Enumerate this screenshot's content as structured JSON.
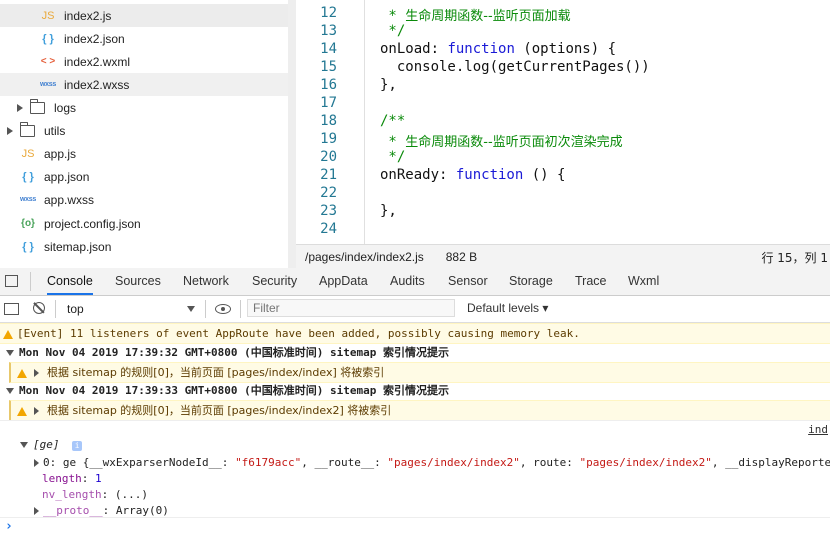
{
  "file_tree": {
    "items": [
      {
        "name": "index2.js",
        "icon": "js-file-icon",
        "icon_text": "JS",
        "selected": true
      },
      {
        "name": "index2.json",
        "icon": "json-file-icon",
        "icon_text": "{ }"
      },
      {
        "name": "index2.wxml",
        "icon": "wxml-file-icon",
        "icon_text": "< >"
      },
      {
        "name": "index2.wxss",
        "icon": "wxss-file-icon",
        "icon_text": "wxss",
        "selected_light": true
      },
      {
        "name": "logs",
        "icon": "folder-icon",
        "collapsed": true
      },
      {
        "name": "utils",
        "icon": "folder-icon",
        "collapsed": true
      },
      {
        "name": "app.js",
        "icon": "js-file-icon",
        "icon_text": "JS"
      },
      {
        "name": "app.json",
        "icon": "json-file-icon",
        "icon_text": "{ }"
      },
      {
        "name": "app.wxss",
        "icon": "wxss-file-icon",
        "icon_text": "wxss"
      },
      {
        "name": "project.config.json",
        "icon": "config-file-icon",
        "icon_text": "{o}"
      },
      {
        "name": "sitemap.json",
        "icon": "json-file-icon",
        "icon_text": "{ }"
      }
    ]
  },
  "editor": {
    "line_numbers": [
      "12",
      "13",
      "14",
      "15",
      "16",
      "17",
      "18",
      "19",
      "20",
      "21",
      "22",
      "23",
      "24"
    ],
    "lines": {
      "l12_star": " * ",
      "l12_text": "生命周期函数--监听页面加载",
      "l13": " */",
      "l14_a": "onLoad: ",
      "l14_kw": "function",
      "l14_b": " (options) {",
      "l15": "  console.log(getCurrentPages())",
      "l16": "},",
      "l18": "/**",
      "l19_star": " * ",
      "l19_text": "生命周期函数--监听页面初次渲染完成",
      "l20": " */",
      "l21_a": "onReady: ",
      "l21_kw": "function",
      "l21_b": " () {",
      "l23": "},"
    }
  },
  "status_bar": {
    "path": "/pages/index/index2.js",
    "size": "882 B",
    "cursor": "行 15，列 1"
  },
  "devtools": {
    "tabs": [
      "Console",
      "Sources",
      "Network",
      "Security",
      "AppData",
      "Audits",
      "Sensor",
      "Storage",
      "Trace",
      "Wxml"
    ],
    "active_tab": "Console",
    "context": "top",
    "filter_placeholder": "Filter",
    "levels": "Default levels ▾"
  },
  "console": {
    "warning1": "[Event] 11 listeners of event AppRoute have been added, possibly causing memory leak.",
    "group1_ts": "Mon Nov 04 2019 17:39:32 GMT+0800 (中国标准时间) sitemap",
    "group1_title": "索引情况提示",
    "group1_msg": "根据 sitemap 的规则[0]，当前页面 [pages/index/index] 将被索引",
    "group2_ts": "Mon Nov 04 2019 17:39:33 GMT+0800 (中国标准时间) sitemap",
    "group2_title": "索引情况提示",
    "group2_msg": "根据 sitemap 的规则[0]，当前页面 [pages/index/index2] 将被索引",
    "source_link": "ind",
    "array_label": "[ge]",
    "item0_prefix": "0: ge {__wxExparserNodeId__: ",
    "item0_id": "\"f6179acc\"",
    "item0_mid": ", __route__: ",
    "item0_route": "\"pages/index/index2\"",
    "item0_mid2": ", route: ",
    "item0_route2": "\"pages/index/index2\"",
    "item0_tail": ", __displayReporte",
    "length_key": "length",
    "length_val": "1",
    "nvlen_key": "nv_length",
    "nvlen_val": "(...)",
    "proto_key": "__proto__",
    "proto_val": "Array(0)",
    "prompt": "›"
  }
}
